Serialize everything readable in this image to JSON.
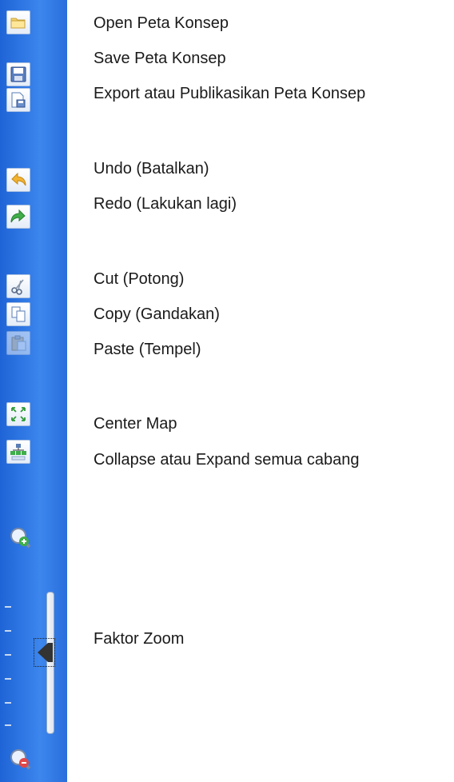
{
  "toolbar": {
    "items": [
      {
        "icon": "folder-open-icon",
        "label": "Open Peta Konsep"
      },
      {
        "icon": "save-disk-icon",
        "label": "Save Peta Konsep"
      },
      {
        "icon": "export-icon",
        "label": "Export atau Publikasikan Peta Konsep"
      },
      {
        "icon": "undo-arrow-icon",
        "label": "Undo (Batalkan)"
      },
      {
        "icon": "redo-arrow-icon",
        "label": "Redo (Lakukan lagi)"
      },
      {
        "icon": "scissors-icon",
        "label": "Cut (Potong)"
      },
      {
        "icon": "copy-icon",
        "label": "Copy (Gandakan)"
      },
      {
        "icon": "paste-icon",
        "label": "Paste (Tempel)"
      },
      {
        "icon": "center-map-icon",
        "label": "Center Map"
      },
      {
        "icon": "collapse-expand-tree-icon",
        "label": "Collapse atau Expand semua cabang"
      }
    ]
  },
  "zoom": {
    "label": "Faktor Zoom",
    "zoom_in_icon": "zoom-in-icon",
    "zoom_out_icon": "zoom-out-icon",
    "level_fraction": 0.67
  },
  "colors": {
    "toolbar_blue": "#2f78e4",
    "undo_yellow": "#f2b233",
    "redo_green": "#3fae49"
  }
}
